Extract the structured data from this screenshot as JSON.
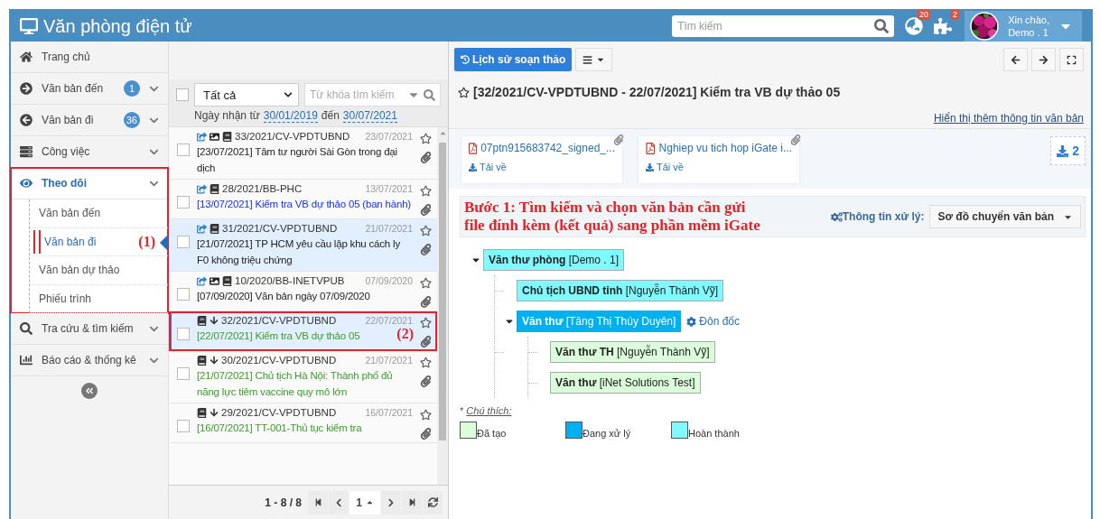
{
  "header": {
    "title": "Văn phòng điện tử",
    "search_placeholder": "Tìm kiếm",
    "notifications": "20",
    "plugins": "2",
    "greeting": "Xin chào,",
    "user": "Demo . 1"
  },
  "sidebar": {
    "items": [
      {
        "label": "Trang chủ",
        "selected": false
      },
      {
        "label": "Văn bản đến",
        "badge": "1",
        "has_submenu": true,
        "selected": false
      },
      {
        "label": "Văn bản đi",
        "badge": "36",
        "has_submenu": true,
        "selected": false
      },
      {
        "label": "Công việc",
        "has_submenu": true,
        "selected": false
      },
      {
        "label": "Theo dõi",
        "has_submenu": true,
        "expanded": true,
        "selected": true,
        "highlighted": true,
        "children": [
          {
            "label": "Văn bản đến",
            "selected": false
          },
          {
            "label": "Văn bản đi",
            "selected": true,
            "callout": "(1)"
          },
          {
            "label": "Văn bản dự thảo",
            "selected": false
          },
          {
            "label": "Phiếu trình",
            "selected": false
          }
        ]
      },
      {
        "label": "Tra cứu & tìm kiếm",
        "has_submenu": true,
        "selected": false
      },
      {
        "label": "Báo cáo & thống kê",
        "has_submenu": true,
        "selected": false
      }
    ]
  },
  "list": {
    "select_all_checked": false,
    "filter": "Tất cả",
    "keyword_placeholder": "Từ khóa tìm kiếm",
    "date_prefix": "Ngày nhận từ",
    "date_from": "30/01/2019",
    "date_mid": "đến",
    "date_to": "30/07/2021",
    "items": [
      {
        "number": "33/2021/CV-VPDTUBND",
        "date": "23/07/2021",
        "title": "[23/07/2021] Tâm tư người Sài Gòn trong đại dịch",
        "color": "#222222",
        "kind": "shared",
        "signed": true,
        "selected": false,
        "shaded": false,
        "checked": false
      },
      {
        "number": "28/2021/BB-PHC",
        "date": "13/07/2021",
        "title": "[13/07/2021] Kiểm tra VB dự thảo 05 (ban hành)",
        "color": "#1a33dd",
        "kind": "shared",
        "signed": false,
        "selected": false,
        "shaded": false,
        "checked": false
      },
      {
        "number": "31/2021/CV-VPDTUBND",
        "date": "21/07/2021",
        "title": "[21/07/2021] TP HCM yêu cầu lập khu cách ly F0 không triệu chứng",
        "color": "#222222",
        "kind": "shared",
        "signed": false,
        "selected": false,
        "shaded": true,
        "checked": false
      },
      {
        "number": "10/2020/BB-INETVPUB",
        "date": "07/09/2020",
        "title": "[07/09/2020] Văn bản ngày 07/09/2020",
        "color": "#222222",
        "kind": "shared",
        "signed": true,
        "selected": false,
        "shaded": false,
        "checked": false
      },
      {
        "number": "32/2021/CV-VPDTUBND",
        "date": "22/07/2021",
        "title": "[22/07/2021] Kiểm tra VB dự thảo 05",
        "color": "#3f9a2e",
        "kind": "received",
        "signed": false,
        "selected": true,
        "shaded": true,
        "checked": false,
        "highlighted": true,
        "callout": "(2)"
      },
      {
        "number": "30/2021/CV-VPDTUBND",
        "date": "21/07/2021",
        "title": "[21/07/2021] Chủ tịch Hà Nội: Thành phố đủ năng lực tiêm vaccine quy mô lớn",
        "color": "#3f9a2e",
        "kind": "received",
        "signed": false,
        "selected": false,
        "shaded": false,
        "checked": false
      },
      {
        "number": "29/2021/CV-VPDTUBND",
        "date": "16/07/2021",
        "title": "[16/07/2021] TT-001-Thủ tục kiểm tra",
        "color": "#3f9a2e",
        "kind": "received",
        "signed": false,
        "selected": false,
        "shaded": false,
        "checked": false
      }
    ],
    "pager": {
      "summary": "1 - 8 / 8",
      "page": "1"
    }
  },
  "detail": {
    "history_button": "Lịch sử soạn thảo",
    "title": "[32/2021/CV-VPDTUBND - 22/07/2021] Kiểm tra VB dự thảo 05",
    "more_link": "Hiển thị thêm thông tin văn bản",
    "attachments": [
      {
        "name": "07ptn915683742_signed_...",
        "download": "Tải về"
      },
      {
        "name": "Nghiep vu tich hop iGate i...",
        "download": "Tải về"
      }
    ],
    "download_count": "2",
    "note_lines": [
      "Bước 1: Tìm kiếm và chọn văn bản cần gửi",
      "file đính kèm (kết quả) sang phần mềm iGate"
    ],
    "info_label": "Thông tin xử lý:",
    "info_select": "Sơ đồ chuyển văn bản",
    "tree": [
      {
        "role": "Văn thư phòng",
        "person": "[Demo . 1]",
        "color": "#7ffaff",
        "expanded": true,
        "children": [
          {
            "role": "Chủ tịch UBND tỉnh",
            "person": "[Nguyễn Thành Vỹ]",
            "color": "#7ffaff"
          },
          {
            "role": "Văn thư",
            "person": "[Tăng Thị Thúy Duyên]",
            "color": "#00b0f0",
            "expanded": true,
            "action": "Đôn đốc",
            "children": [
              {
                "role": "Văn thư TH",
                "person": "[Nguyễn Thành Vỹ]",
                "color": "#dcfddb"
              },
              {
                "role": "Văn thư",
                "person": "[iNet Solutions Test]",
                "color": "#dcfddb"
              }
            ]
          }
        ]
      }
    ],
    "legend_marker": "*",
    "legend_title": "Chú thích:",
    "legend": [
      {
        "label": "Đã tạo",
        "color": "#dcfddb"
      },
      {
        "label": "Đang xử lý",
        "color": "#00b0f0"
      },
      {
        "label": "Hoàn thành",
        "color": "#7ffaff"
      }
    ]
  }
}
